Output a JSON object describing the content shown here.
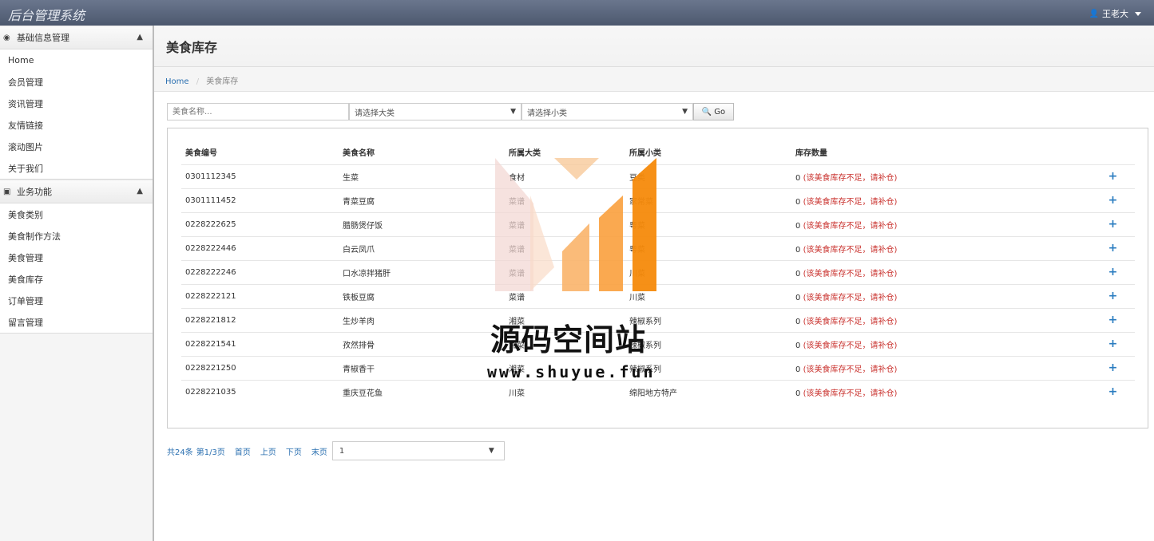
{
  "app": {
    "title": "后台管理系统",
    "user": "王老大"
  },
  "sidebar": {
    "groups": [
      {
        "title": "基础信息管理",
        "icon": "dashboard-icon",
        "items": [
          "Home",
          "会员管理",
          "资讯管理",
          "友情链接",
          "滚动图片",
          "关于我们"
        ]
      },
      {
        "title": "业务功能",
        "icon": "briefcase-icon",
        "items": [
          "美食类别",
          "美食制作方法",
          "美食管理",
          "美食库存",
          "订单管理",
          "留言管理"
        ]
      }
    ]
  },
  "page": {
    "title": "美食库存",
    "breadcrumb": {
      "home": "Home",
      "current": "美食库存"
    }
  },
  "search": {
    "name_placeholder": "美食名称...",
    "category_select": "请选择大类",
    "subcategory_select": "请选择小类",
    "go_label": "Go"
  },
  "table": {
    "headers": [
      "美食编号",
      "美食名称",
      "所属大类",
      "所属小类",
      "库存数量"
    ],
    "rows": [
      {
        "id": "0301112345",
        "name": "生菜",
        "cat": "食材",
        "sub": "豆类",
        "qty": "0",
        "warn": "(该美食库存不足，请补仓)"
      },
      {
        "id": "0301111452",
        "name": "青菜豆腐",
        "cat": "菜谱",
        "sub": "家常菜",
        "qty": "0",
        "warn": "(该美食库存不足，请补仓)"
      },
      {
        "id": "0228222625",
        "name": "腊肠煲仔饭",
        "cat": "菜谱",
        "sub": "粤菜",
        "qty": "0",
        "warn": "(该美食库存不足，请补仓)"
      },
      {
        "id": "0228222446",
        "name": "白云凤爪",
        "cat": "菜谱",
        "sub": "粤菜",
        "qty": "0",
        "warn": "(该美食库存不足，请补仓)"
      },
      {
        "id": "0228222246",
        "name": "口水凉拌猪肝",
        "cat": "菜谱",
        "sub": "川菜",
        "qty": "0",
        "warn": "(该美食库存不足，请补仓)"
      },
      {
        "id": "0228222121",
        "name": "铁板豆腐",
        "cat": "菜谱",
        "sub": "川菜",
        "qty": "0",
        "warn": "(该美食库存不足，请补仓)"
      },
      {
        "id": "0228221812",
        "name": "生炒羊肉",
        "cat": "湘菜",
        "sub": "辣椒系列",
        "qty": "0",
        "warn": "(该美食库存不足，请补仓)"
      },
      {
        "id": "0228221541",
        "name": "孜然排骨",
        "cat": "湘菜",
        "sub": "辣椒系列",
        "qty": "0",
        "warn": "(该美食库存不足，请补仓)"
      },
      {
        "id": "0228221250",
        "name": "青椒香干",
        "cat": "湘菜",
        "sub": "辣椒系列",
        "qty": "0",
        "warn": "(该美食库存不足，请补仓)"
      },
      {
        "id": "0228221035",
        "name": "重庆豆花鱼",
        "cat": "川菜",
        "sub": "绵阳地方特产",
        "qty": "0",
        "warn": "(该美食库存不足，请补仓)"
      }
    ]
  },
  "pager": {
    "total": "共24条",
    "page": "第1/3页",
    "first": "首页",
    "prev": "上页",
    "next": "下页",
    "last": "末页",
    "select": "1"
  },
  "watermark": {
    "text": "源码空间站",
    "url": "www.shuyue.fun"
  }
}
